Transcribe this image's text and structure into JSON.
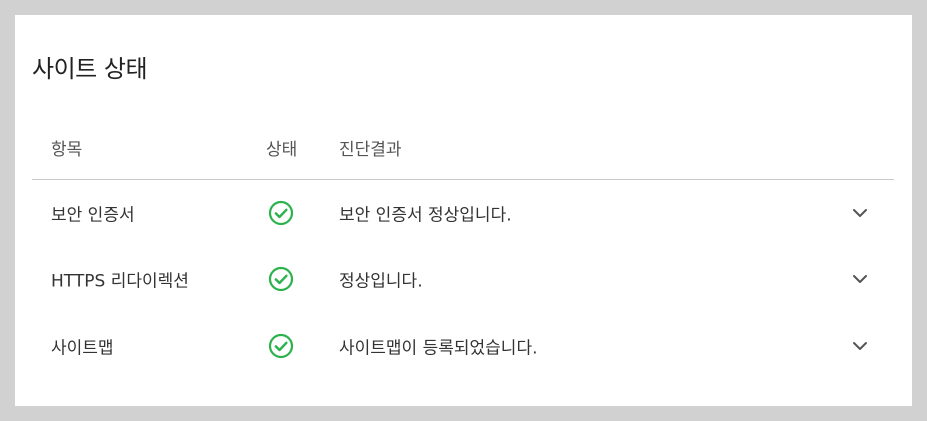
{
  "card": {
    "title": "사이트 상태"
  },
  "columns": {
    "item": "항목",
    "status": "상태",
    "result": "진단결과"
  },
  "colors": {
    "status_ok": "#2bb24c",
    "chevron": "#555555",
    "divider": "#c8c8c8",
    "page_bg": "#d1d1d1"
  },
  "rows": [
    {
      "item": "보안 인증서",
      "status_icon": "check-circle-icon",
      "result": "보안 인증서 정상입니다."
    },
    {
      "item": "HTTPS 리다이렉션",
      "status_icon": "check-circle-icon",
      "result": "정상입니다."
    },
    {
      "item": "사이트맵",
      "status_icon": "check-circle-icon",
      "result": "사이트맵이 등록되었습니다."
    }
  ]
}
